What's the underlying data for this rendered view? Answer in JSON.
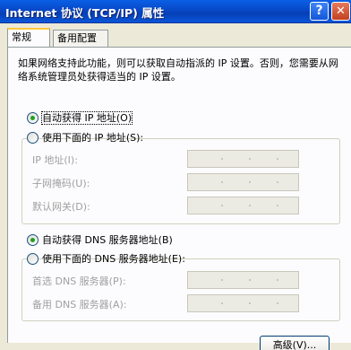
{
  "window": {
    "title": "Internet 协议 (TCP/IP) 属性",
    "help_glyph": "?",
    "close_glyph": "✕"
  },
  "tabs": [
    {
      "label": "常规",
      "active": true
    },
    {
      "label": "备用配置",
      "active": false
    }
  ],
  "description": "如果网络支持此功能，则可以获取自动指派的 IP 设置。否则，您需要从网络系统管理员处获得适当的 IP 设置。",
  "ip_mode": {
    "auto_label": "自动获得 IP 地址(O)",
    "manual_label": "使用下面的 IP 地址(S):",
    "selected": "auto"
  },
  "ip_fields": [
    {
      "label": "IP 地址(I):",
      "value": ""
    },
    {
      "label": "子网掩码(U):",
      "value": ""
    },
    {
      "label": "默认网关(D):",
      "value": ""
    }
  ],
  "dns_mode": {
    "auto_label": "自动获得 DNS 服务器地址(B)",
    "manual_label": "使用下面的 DNS 服务器地址(E):",
    "selected": "auto"
  },
  "dns_fields": [
    {
      "label": "首选 DNS 服务器(P):",
      "value": ""
    },
    {
      "label": "备用 DNS 服务器(A):",
      "value": ""
    }
  ],
  "advanced_button": "高级(V)...",
  "colors": {
    "title_bar": "#0a55d9",
    "dialog_bg": "#ece9d8",
    "panel_bg": "#fcfcfe",
    "disabled_text": "#a0a0a0",
    "radio_dot": "#21a121"
  }
}
